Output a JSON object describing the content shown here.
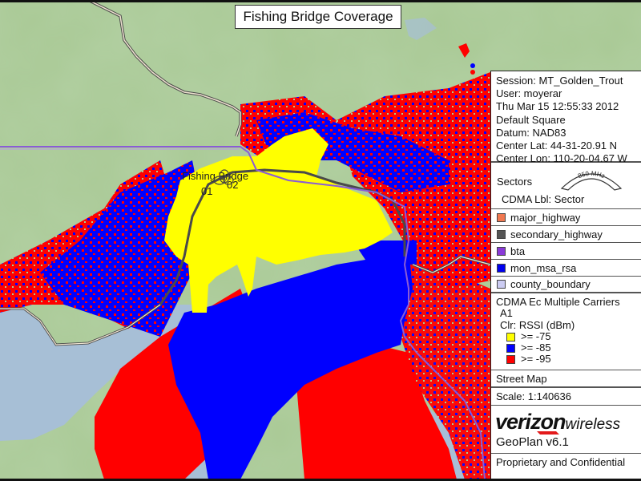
{
  "map": {
    "title": "Fishing Bridge Coverage",
    "site_label": "Fishing Bridge",
    "sector_labels": [
      "01",
      "02"
    ],
    "colors": {
      "terrain": "#a9c995",
      "water": "#a7bfd6",
      "rssi_strong": "#ffff00",
      "rssi_medium": "#0000ff",
      "rssi_weak": "#ff0000",
      "bta_line": "#8a5cd6",
      "highway": "#5a5a5a"
    }
  },
  "legend": {
    "session_info": [
      "Session: MT_Golden_Trout",
      "User: moyerar",
      "Thu Mar 15 12:55:33 2012",
      "Default Square",
      "Datum: NAD83",
      "Center Lat: 44-31-20.91 N",
      "Center Lon: 110-20-04.67 W"
    ],
    "sectors_label": "Sectors",
    "band_label": "850 MHz",
    "cdma_label": "CDMA Lbl: Sector",
    "layers": [
      {
        "label": "major_highway",
        "color": "#f07850"
      },
      {
        "label": "secondary_highway",
        "color": "#555555"
      },
      {
        "label": "bta",
        "color": "#8a3ad8"
      },
      {
        "label": "mon_msa_rsa",
        "color": "#0000ee"
      },
      {
        "label": "county_boundary",
        "color": "#ccccf2"
      }
    ],
    "coverage_title": "CDMA Ec Multiple Carriers",
    "carrier": "A1",
    "color_by": "Clr: RSSI (dBm)",
    "rssi_bins": [
      {
        "label": ">= -75",
        "color": "#ffff00"
      },
      {
        "label": ">= -85",
        "color": "#0000ff"
      },
      {
        "label": ">= -95",
        "color": "#ff0000"
      }
    ],
    "basemap": "Street Map",
    "scale": "Scale: 1:140636",
    "brand_main": "verizon",
    "brand_sub": "wireless",
    "software": "GeoPlan v6.1",
    "footer": "Proprietary and Confidential"
  }
}
